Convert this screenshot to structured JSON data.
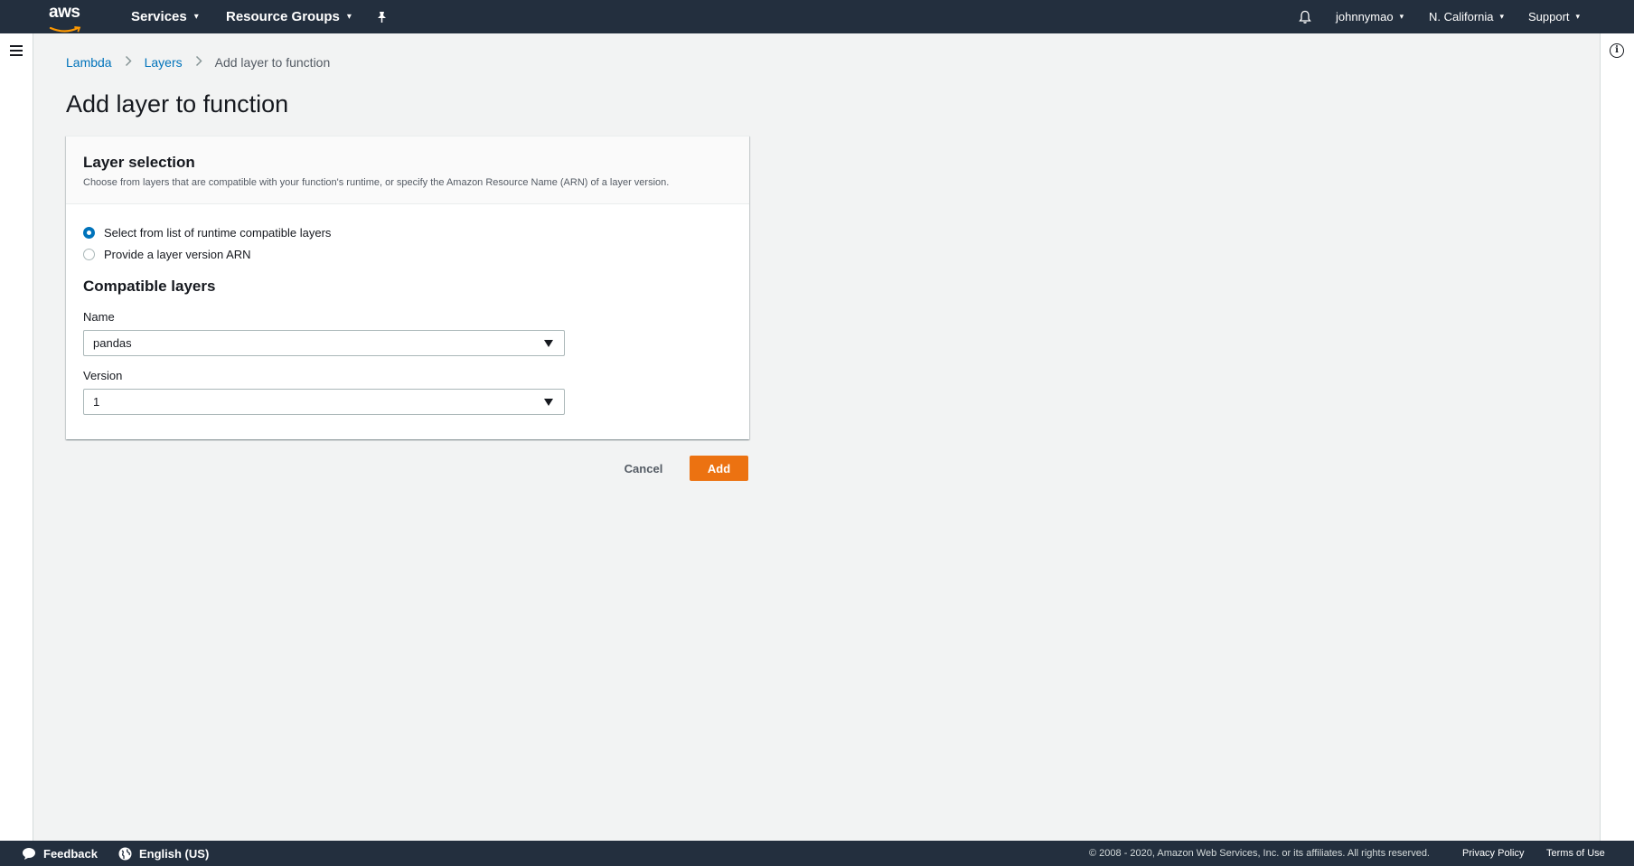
{
  "topnav": {
    "logo_text": "aws",
    "services": "Services",
    "resource_groups": "Resource Groups",
    "user": "johnnymao",
    "region": "N. California",
    "support": "Support"
  },
  "breadcrumb": {
    "lambda": "Lambda",
    "layers": "Layers",
    "current": "Add layer to function"
  },
  "page_title": "Add layer to function",
  "panel": {
    "title": "Layer selection",
    "description": "Choose from layers that are compatible with your function's runtime, or specify the Amazon Resource Name (ARN) of a layer version.",
    "radio_options": [
      {
        "label": "Select from list of runtime compatible layers",
        "checked": true
      },
      {
        "label": "Provide a layer version ARN",
        "checked": false
      }
    ],
    "section_title": "Compatible layers",
    "name_label": "Name",
    "name_value": "pandas",
    "version_label": "Version",
    "version_value": "1"
  },
  "actions": {
    "cancel": "Cancel",
    "add": "Add"
  },
  "footer": {
    "feedback": "Feedback",
    "language": "English (US)",
    "copyright": "© 2008 - 2020, Amazon Web Services, Inc. or its affiliates. All rights reserved.",
    "privacy": "Privacy Policy",
    "terms": "Terms of Use"
  },
  "colors": {
    "nav_bg": "#232f3e",
    "accent_orange": "#ec7211",
    "link_blue": "#0073bb",
    "page_bg": "#f2f3f3"
  }
}
